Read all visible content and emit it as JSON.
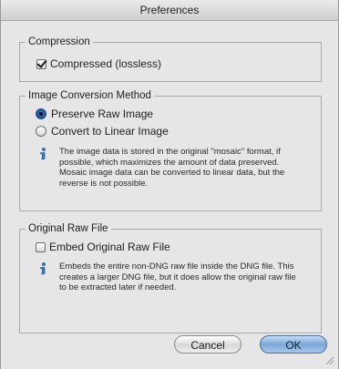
{
  "window": {
    "title": "Preferences"
  },
  "compression": {
    "legend": "Compression",
    "checkbox_label": "Compressed (lossless)",
    "checked": true
  },
  "conversion": {
    "legend": "Image Conversion Method",
    "options": [
      {
        "label": "Preserve Raw Image",
        "selected": true
      },
      {
        "label": "Convert to Linear Image",
        "selected": false
      }
    ],
    "info_lines": [
      "The image data is stored in the original \"mosaic\" format, if",
      "possible, which maximizes the amount of data preserved.",
      "Mosaic image data can be converted to linear data, but the",
      "reverse is not possible."
    ]
  },
  "original_raw": {
    "legend": "Original Raw File",
    "checkbox_label": "Embed Original Raw File",
    "checked": false,
    "info_lines": [
      "Embeds the entire non-DNG raw file inside the DNG file.  This",
      "creates a larger DNG file, but it does allow the original raw file",
      "to be extracted later if needed."
    ]
  },
  "buttons": {
    "cancel": "Cancel",
    "ok": "OK"
  },
  "colors": {
    "default_button": "#7aa7d8",
    "radio_selected": "#1e4f9a",
    "info_icon": "#3a6fb0"
  }
}
